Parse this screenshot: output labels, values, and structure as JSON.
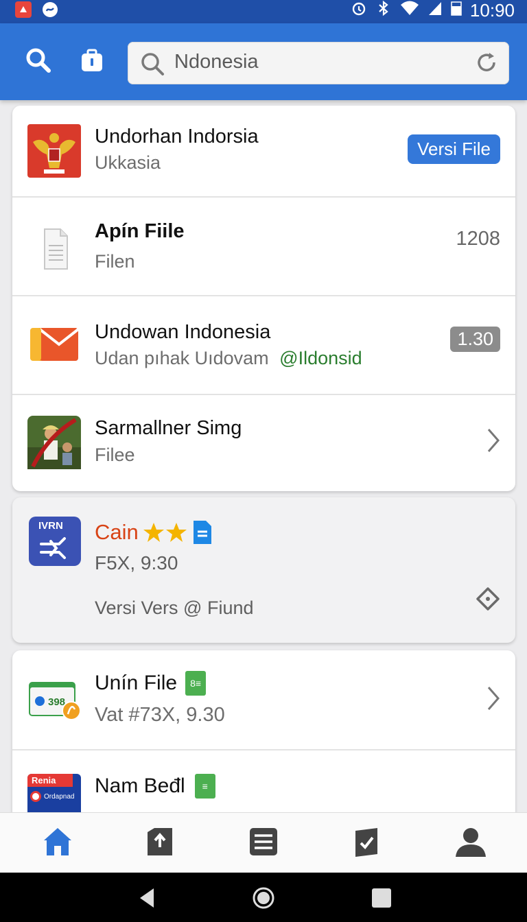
{
  "status_bar": {
    "time": "10:90"
  },
  "search": {
    "value": "Ndonesia"
  },
  "items": [
    {
      "title": "Undorhan Indorsia",
      "subtitle": "Ukkasia",
      "badge": "Versi File"
    },
    {
      "title": "Apín Fiile",
      "subtitle": "Filen",
      "count": "1208"
    },
    {
      "title": "Undowan Indonesia",
      "subtitle": "Udan pıhak Uıdovam",
      "handle": "@Ildonsid",
      "badge": "1.30"
    },
    {
      "title": "Sarmallner Simg",
      "subtitle": "Filee"
    }
  ],
  "featured": {
    "icon_label": "IVRN",
    "title": "Cain",
    "meta": "F5X, 9:30",
    "footer": "Versi Vers @ Fiund",
    "accent": "#d84315"
  },
  "items2": [
    {
      "title": "Unín File",
      "subtitle": "Vat #73X, 9.30",
      "icon_text": "398",
      "doc_glyph": "8≡"
    },
    {
      "title": "Nam Beđl",
      "icon_label_top": "Renia",
      "icon_label_bottom": "Ordapnad",
      "doc_glyph": "≡"
    }
  ],
  "bottom_nav": [
    "home-icon",
    "upload-icon",
    "list-icon",
    "tasks-icon",
    "profile-icon"
  ],
  "colors": {
    "primary": "#2f74d6",
    "status_bar": "#1f4fa8",
    "green": "#2a7d2e",
    "badge_blue": "#3478d9"
  }
}
